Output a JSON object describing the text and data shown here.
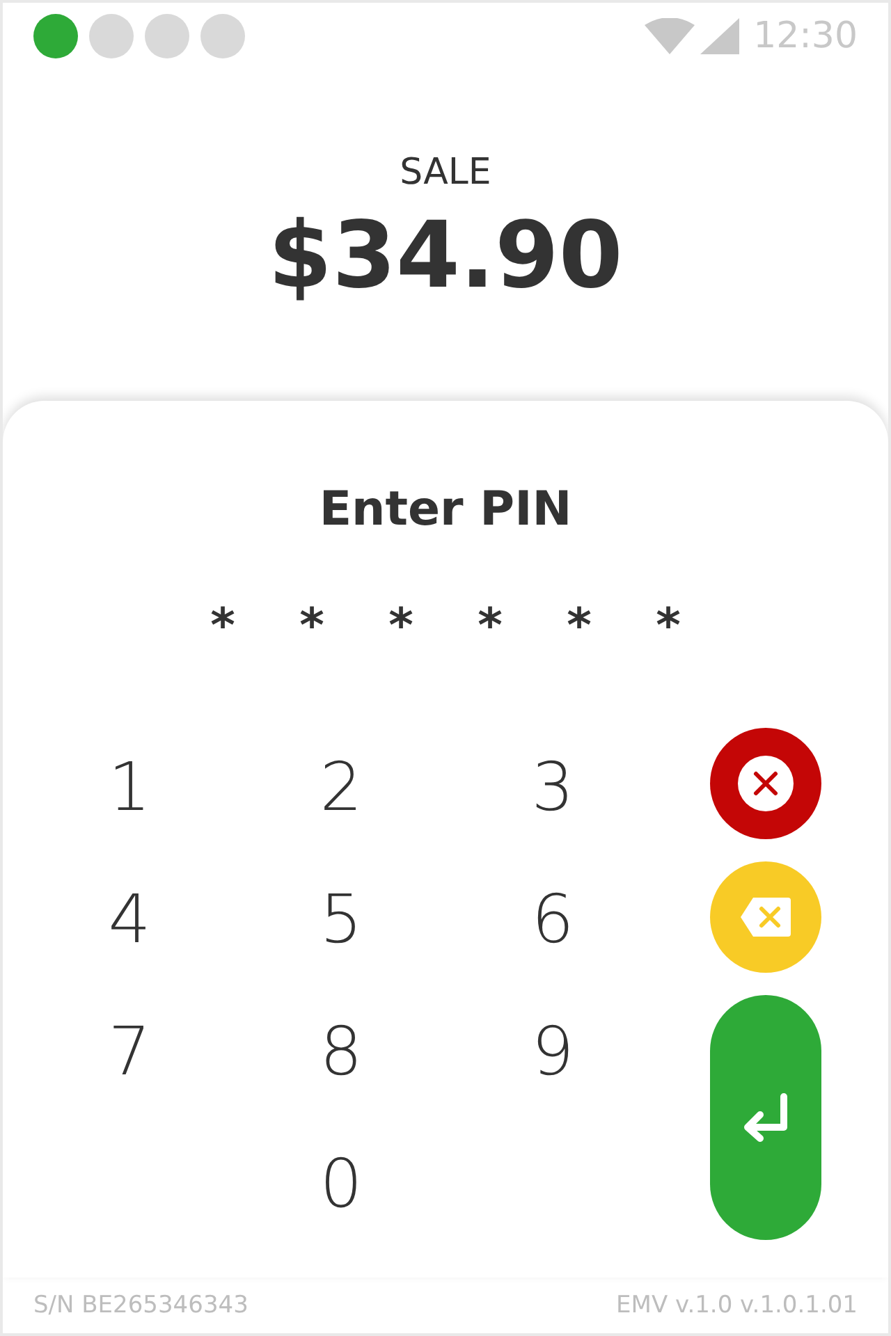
{
  "status_bar": {
    "indicators": [
      {
        "on": true
      },
      {
        "on": false
      },
      {
        "on": false
      },
      {
        "on": false
      }
    ],
    "time": "12:30"
  },
  "transaction": {
    "type": "SALE",
    "amount": "$34.90"
  },
  "pin_entry": {
    "title": "Enter PIN",
    "mask": [
      "*",
      "*",
      "*",
      "*",
      "*",
      "*"
    ]
  },
  "keypad": {
    "keys": [
      "1",
      "2",
      "3",
      "4",
      "5",
      "6",
      "7",
      "8",
      "9",
      "0"
    ],
    "actions": [
      {
        "kind": "cancel"
      },
      {
        "kind": "clear"
      },
      {
        "kind": "enter"
      }
    ]
  },
  "footer": {
    "serial": "S/N BE265346343",
    "version": "EMV v.1.0 v.1.0.1.01"
  }
}
